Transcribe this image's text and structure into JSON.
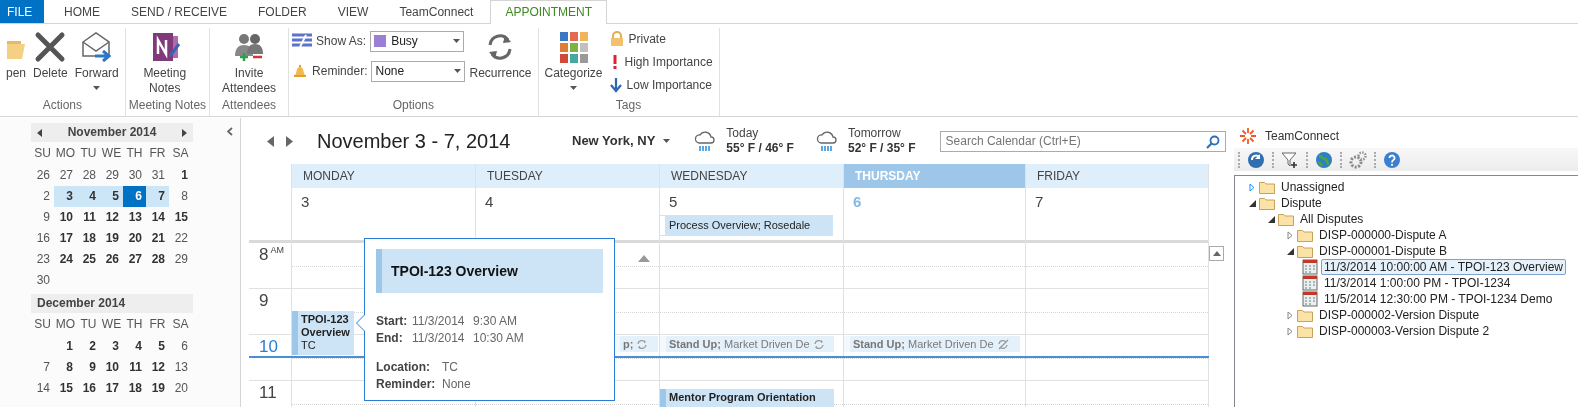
{
  "ribbon_tabs": [
    {
      "label": "FILE",
      "kind": "file",
      "selected": false
    },
    {
      "label": "HOME",
      "kind": "tab",
      "selected": false
    },
    {
      "label": "SEND / RECEIVE",
      "kind": "tab",
      "selected": false
    },
    {
      "label": "FOLDER",
      "kind": "tab",
      "selected": false
    },
    {
      "label": "VIEW",
      "kind": "tab",
      "selected": false
    },
    {
      "label": "TeamConnect",
      "kind": "tab",
      "selected": false
    },
    {
      "label": "APPOINTMENT",
      "kind": "tab",
      "selected": true
    }
  ],
  "ribbon_groups": [
    {
      "label": "Actions",
      "items": [
        {
          "kind": "large",
          "label": "pen"
        },
        {
          "kind": "large",
          "label": "Delete"
        },
        {
          "kind": "large_dropdown",
          "label": "Forward"
        }
      ]
    },
    {
      "label": "Meeting Notes",
      "items": [
        {
          "kind": "large",
          "label": "Meeting Notes"
        }
      ]
    },
    {
      "label": "Attendees",
      "items": [
        {
          "kind": "large",
          "label": "Invite Attendees"
        }
      ]
    },
    {
      "label": "Options",
      "items": [
        {
          "kind": "status_dropdown",
          "label": "Show As:",
          "value": "Busy"
        },
        {
          "kind": "dropdown",
          "label": "Reminder:",
          "value": "None"
        },
        {
          "kind": "large",
          "label": "Recurrence"
        }
      ]
    },
    {
      "label": "Tags",
      "items": [
        {
          "kind": "large_dropdown",
          "label": "Categorize"
        },
        {
          "kind": "small",
          "label": "Private"
        },
        {
          "kind": "small",
          "label": "High Importance"
        },
        {
          "kind": "small",
          "label": "Low Importance"
        }
      ]
    }
  ],
  "mini_calendars": [
    {
      "title": "November 2014",
      "weekdays": [
        "SU",
        "MO",
        "TU",
        "WE",
        "TH",
        "FR",
        "SA"
      ],
      "weeks": [
        [
          {
            "day": "26",
            "bold": false,
            "selected": false,
            "today": false
          },
          {
            "day": "27",
            "bold": false,
            "selected": false,
            "today": false
          },
          {
            "day": "28",
            "bold": false,
            "selected": false,
            "today": false
          },
          {
            "day": "29",
            "bold": false,
            "selected": false,
            "today": false
          },
          {
            "day": "30",
            "bold": false,
            "selected": false,
            "today": false
          },
          {
            "day": "31",
            "bold": false,
            "selected": false,
            "today": false
          },
          {
            "day": "1",
            "bold": true,
            "selected": false,
            "today": false
          }
        ],
        [
          {
            "day": "2",
            "bold": false,
            "selected": false,
            "today": false
          },
          {
            "day": "3",
            "bold": true,
            "selected": true,
            "today": false
          },
          {
            "day": "4",
            "bold": true,
            "selected": true,
            "today": false
          },
          {
            "day": "5",
            "bold": true,
            "selected": true,
            "today": false
          },
          {
            "day": "6",
            "bold": true,
            "selected": true,
            "today": true
          },
          {
            "day": "7",
            "bold": true,
            "selected": true,
            "today": false
          },
          {
            "day": "8",
            "bold": false,
            "selected": false,
            "today": false
          }
        ],
        [
          {
            "day": "9",
            "bold": false,
            "selected": false,
            "today": false
          },
          {
            "day": "10",
            "bold": true,
            "selected": false,
            "today": false
          },
          {
            "day": "11",
            "bold": true,
            "selected": false,
            "today": false
          },
          {
            "day": "12",
            "bold": true,
            "selected": false,
            "today": false
          },
          {
            "day": "13",
            "bold": true,
            "selected": false,
            "today": false
          },
          {
            "day": "14",
            "bold": true,
            "selected": false,
            "today": false
          },
          {
            "day": "15",
            "bold": true,
            "selected": false,
            "today": false
          }
        ],
        [
          {
            "day": "16",
            "bold": false,
            "selected": false,
            "today": false
          },
          {
            "day": "17",
            "bold": true,
            "selected": false,
            "today": false
          },
          {
            "day": "18",
            "bold": true,
            "selected": false,
            "today": false
          },
          {
            "day": "19",
            "bold": true,
            "selected": false,
            "today": false
          },
          {
            "day": "20",
            "bold": true,
            "selected": false,
            "today": false
          },
          {
            "day": "21",
            "bold": true,
            "selected": false,
            "today": false
          },
          {
            "day": "22",
            "bold": false,
            "selected": false,
            "today": false
          }
        ],
        [
          {
            "day": "23",
            "bold": false,
            "selected": false,
            "today": false
          },
          {
            "day": "24",
            "bold": true,
            "selected": false,
            "today": false
          },
          {
            "day": "25",
            "bold": true,
            "selected": false,
            "today": false
          },
          {
            "day": "26",
            "bold": true,
            "selected": false,
            "today": false
          },
          {
            "day": "27",
            "bold": true,
            "selected": false,
            "today": false
          },
          {
            "day": "28",
            "bold": true,
            "selected": false,
            "today": false
          },
          {
            "day": "29",
            "bold": false,
            "selected": false,
            "today": false
          }
        ],
        [
          {
            "day": "30",
            "bold": false,
            "selected": false,
            "today": false
          }
        ]
      ]
    },
    {
      "title": "December 2014",
      "weekdays": [
        "SU",
        "MO",
        "TU",
        "WE",
        "TH",
        "FR",
        "SA"
      ],
      "weeks": [
        [
          {
            "day": "1",
            "bold": true,
            "selected": false,
            "today": false
          },
          {
            "day": "2",
            "bold": true,
            "selected": false,
            "today": false
          },
          {
            "day": "3",
            "bold": true,
            "selected": false,
            "today": false
          },
          {
            "day": "4",
            "bold": true,
            "selected": false,
            "today": false
          },
          {
            "day": "5",
            "bold": true,
            "selected": false,
            "today": false
          },
          {
            "day": "6",
            "bold": false,
            "selected": false,
            "today": false
          }
        ],
        [
          {
            "day": "7",
            "bold": false,
            "selected": false,
            "today": false
          },
          {
            "day": "8",
            "bold": true,
            "selected": false,
            "today": false
          },
          {
            "day": "9",
            "bold": true,
            "selected": false,
            "today": false
          },
          {
            "day": "10",
            "bold": true,
            "selected": false,
            "today": false
          },
          {
            "day": "11",
            "bold": true,
            "selected": false,
            "today": false
          },
          {
            "day": "12",
            "bold": true,
            "selected": false,
            "today": false
          },
          {
            "day": "13",
            "bold": false,
            "selected": false,
            "today": false
          }
        ],
        [
          {
            "day": "14",
            "bold": false,
            "selected": false,
            "today": false
          },
          {
            "day": "15",
            "bold": true,
            "selected": false,
            "today": false
          },
          {
            "day": "16",
            "bold": true,
            "selected": false,
            "today": false
          },
          {
            "day": "17",
            "bold": true,
            "selected": false,
            "today": false
          },
          {
            "day": "18",
            "bold": true,
            "selected": false,
            "today": false
          },
          {
            "day": "19",
            "bold": true,
            "selected": false,
            "today": false
          },
          {
            "day": "20",
            "bold": false,
            "selected": false,
            "today": false
          }
        ]
      ]
    }
  ],
  "calendar": {
    "title": "November 3 - 7, 2014",
    "location": "New York, NY",
    "weather": [
      {
        "label": "Today",
        "temps": "55° F / 46° F"
      },
      {
        "label": "Tomorrow",
        "temps": "52° F / 35° F"
      }
    ],
    "search": {
      "placeholder": "Search Calendar (Ctrl+E)"
    },
    "hours": [
      {
        "hour": "8",
        "suffix": "AM",
        "current": false
      },
      {
        "hour": "9",
        "current": false
      },
      {
        "hour": "10",
        "current": true
      },
      {
        "hour": "11",
        "current": false
      }
    ],
    "days": [
      {
        "name": "MONDAY",
        "date": "3",
        "today": false,
        "events": [
          {
            "title": "TPOI-123 Overview",
            "location": "TC",
            "tentative": false
          }
        ]
      },
      {
        "name": "TUESDAY",
        "date": "4",
        "today": false,
        "events": [
          {
            "title": "**p;**",
            "tentative": true,
            "recurring": true
          }
        ]
      },
      {
        "name": "WEDNESDAY",
        "date": "5",
        "today": false,
        "all_day": [
          {
            "title": "Process Overview; Rosedale"
          }
        ],
        "events": [
          {
            "title": "**Stand Up;** Market Driven De",
            "tentative": true,
            "recurring": true
          },
          {
            "title": "Mentor Program Orientation",
            "tentative": false
          }
        ]
      },
      {
        "name": "THURSDAY",
        "date": "6",
        "today": true,
        "events": [
          {
            "title": "**Stand Up;** Market Driven De",
            "tentative": true,
            "recurring": true,
            "exception": true
          }
        ]
      },
      {
        "name": "FRIDAY",
        "date": "7",
        "today": false
      }
    ],
    "popup": {
      "title": "TPOI-123 Overview",
      "fields": [
        {
          "kind": "datetime",
          "label": "Start:",
          "date": "11/3/2014",
          "time": "9:30 AM"
        },
        {
          "kind": "datetime",
          "label": "End:",
          "date": "11/3/2014",
          "time": "10:30 AM"
        },
        {
          "kind": "detail",
          "label": "Location:",
          "value": "TC"
        },
        {
          "kind": "detail",
          "label": "Reminder:",
          "value": "None"
        }
      ]
    }
  },
  "side_pane": {
    "title": "TeamConnect",
    "tree": [
      {
        "kind": "folder",
        "label": "Unassigned",
        "expanded": false,
        "selected": false
      },
      {
        "kind": "folder",
        "label": "Dispute",
        "expanded": true,
        "selected": false,
        "children": [
          {
            "kind": "folder",
            "label": "All Disputes",
            "expanded": true,
            "selected": false,
            "children": [
              {
                "kind": "folder",
                "label": "DISP-000000-Dispute A",
                "expanded": false,
                "selected": false
              },
              {
                "kind": "folder",
                "label": "DISP-000001-Dispute B",
                "expanded": true,
                "selected": false,
                "children": [
                  {
                    "kind": "appointment",
                    "label": "11/3/2014 10:00:00 AM - TPOI-123 Overview",
                    "selected": true
                  },
                  {
                    "kind": "appointment",
                    "label": "11/3/2014 1:00:00 PM - TPOI-1234",
                    "selected": false
                  },
                  {
                    "kind": "appointment",
                    "label": "11/5/2014 12:30:00 PM - TPOI-1234 Demo",
                    "selected": false
                  }
                ]
              },
              {
                "kind": "folder",
                "label": "DISP-000002-Version Dispute",
                "expanded": false,
                "selected": false
              },
              {
                "kind": "folder",
                "label": "DISP-000003-Version Dispute 2",
                "expanded": false,
                "selected": false
              }
            ]
          }
        ]
      }
    ]
  }
}
